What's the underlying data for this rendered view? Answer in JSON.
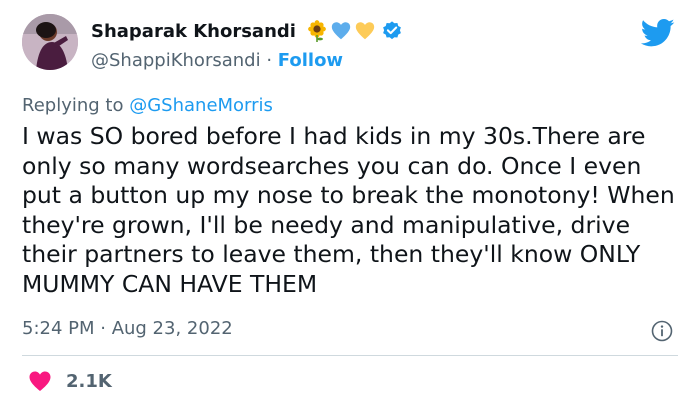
{
  "author": {
    "display_name": "Shaparak Khorsandi",
    "handle": "@ShappiKhorsandi",
    "separator": "·",
    "follow_label": "Follow",
    "emojis": [
      "sunflower-icon",
      "blue-heart-icon",
      "yellow-heart-icon"
    ],
    "verified": true
  },
  "reply": {
    "prefix": "Replying to",
    "mention": "@GShaneMorris"
  },
  "tweet": {
    "text": "I was SO bored before I had kids in my 30s.There are only so many wordsearches you can do. Once I even put a button up my nose to break the monotony! When they're grown, I'll be needy and manipulative, drive their partners to leave them, then they'll know ONLY MUMMY CAN HAVE THEM"
  },
  "meta": {
    "timestamp": "5:24 PM · Aug 23, 2022"
  },
  "stats": {
    "likes": "2.1K"
  },
  "colors": {
    "accent": "#1d9bf0",
    "heart": "#f91880",
    "muted": "#536471"
  }
}
